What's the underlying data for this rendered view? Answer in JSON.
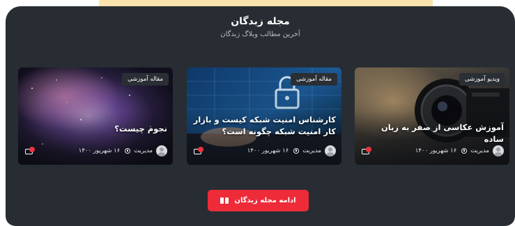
{
  "section": {
    "title": "مجله زبدگان",
    "subtitle": "آخرین مطالب وبلاگ زبدگان"
  },
  "cards": [
    {
      "badge": "ویدیو آموزشی",
      "title": "آموزش عکاسی از صفر به زبان ساده",
      "author": "مدیریت",
      "date": "۱۶ شهریور ۱۴۰۰"
    },
    {
      "badge": "مقاله آموزشی",
      "title": "کارشناس امنیت شبکه کیست و بازار کار امنیت شبکه چگونه است؟",
      "author": "مدیریت",
      "date": "۱۶ شهریور ۱۴۰۰"
    },
    {
      "badge": "مقاله آموزشی",
      "title": "نجوم چیست؟",
      "author": "مدیریت",
      "date": "۱۶ شهریور ۱۴۰۰"
    }
  ],
  "cta": {
    "label": "ادامه مجله زبدگان"
  },
  "colors": {
    "panel": "#272d33",
    "accent": "#ee2b39",
    "top_strip": "#fbe3ad"
  },
  "icons": [
    "user-avatar-icon",
    "clock-icon",
    "comment-icon",
    "book-icon"
  ]
}
